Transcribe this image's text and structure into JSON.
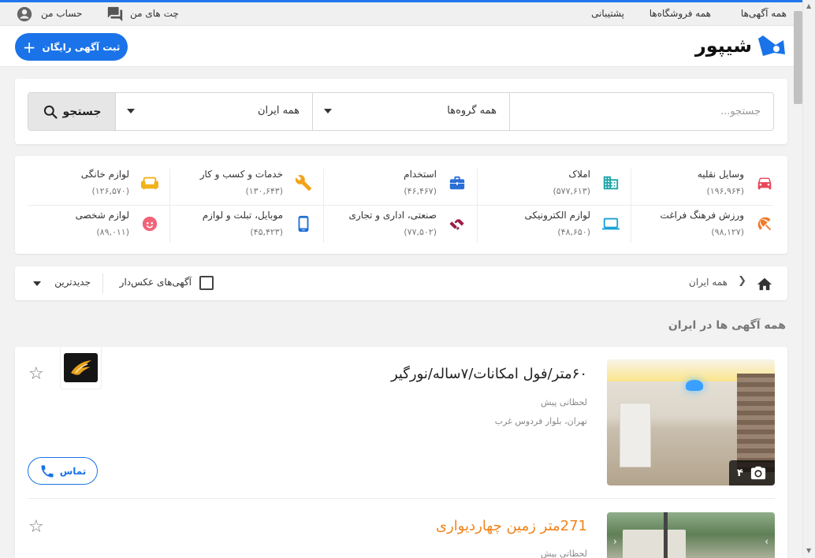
{
  "topnav": {
    "all_ads": "همه آگهی‌ها",
    "all_stores": "همه فروشگاه‌ها",
    "support": "پشتیبانی",
    "my_chats": "چت های من",
    "account": "حساب من"
  },
  "header": {
    "logo_text": "شیپور",
    "post_ad": "ثبت آگهی رایگان"
  },
  "search": {
    "placeholder": "جستجو...",
    "category_value": "همه گروه‌ها",
    "location_value": "همه ایران",
    "button_label": "جستجو"
  },
  "categories": [
    {
      "name": "وسایل نقلیه",
      "count": "(۱۹۶,۹۶۴)",
      "icon": "car-icon",
      "color": "#e8455a"
    },
    {
      "name": "املاک",
      "count": "(۵۷۷,۶۱۳)",
      "icon": "building-icon",
      "color": "#1aa3a8"
    },
    {
      "name": "استخدام",
      "count": "(۴۶,۴۶۷)",
      "icon": "briefcase-icon",
      "color": "#2a6fd6"
    },
    {
      "name": "خدمات و کسب و کار",
      "count": "(۱۳۰,۶۴۳)",
      "icon": "wrench-icon",
      "color": "#f2a31b"
    },
    {
      "name": "لوازم خانگی",
      "count": "(۱۲۶,۵۷۰)",
      "icon": "sofa-icon",
      "color": "#f2b21b"
    },
    {
      "name": "ورزش فرهنگ فراغت",
      "count": "(۹۸,۱۲۷)",
      "icon": "umbrella-icon",
      "color": "#f07a2a"
    },
    {
      "name": "لوازم الکترونیکی",
      "count": "(۴۸,۶۵۰)",
      "icon": "laptop-icon",
      "color": "#1ba1d9"
    },
    {
      "name": "صنعتی، اداری و تجاری",
      "count": "(۷۷,۵۰۲)",
      "icon": "handshake-icon",
      "color": "#9b1d4a"
    },
    {
      "name": "موبایل، تبلت و لوازم",
      "count": "(۴۵,۴۲۳)",
      "icon": "mobile-icon",
      "color": "#1f6fd8"
    },
    {
      "name": "لوازم شخصی",
      "count": "(۸۹,۰۱۱)",
      "icon": "face-icon",
      "color": "#f2637a"
    }
  ],
  "filter": {
    "breadcrumb": "همه ایران",
    "photo_only": "آگهی‌های عکس‌دار",
    "sort": "جدیدترین"
  },
  "section_title": "همه آگهی ها در ایران",
  "ads": [
    {
      "title": "۶۰متر/فول امکانات/۷ساله/نورگیر",
      "time": "لحظاتی پیش",
      "location": "تهران، بلوار فردوس غرب",
      "photo_count": "۴",
      "call_label": "تماس"
    },
    {
      "title": "271متر زمین چهاردیواری",
      "time": "لحظاتی پیش"
    }
  ]
}
